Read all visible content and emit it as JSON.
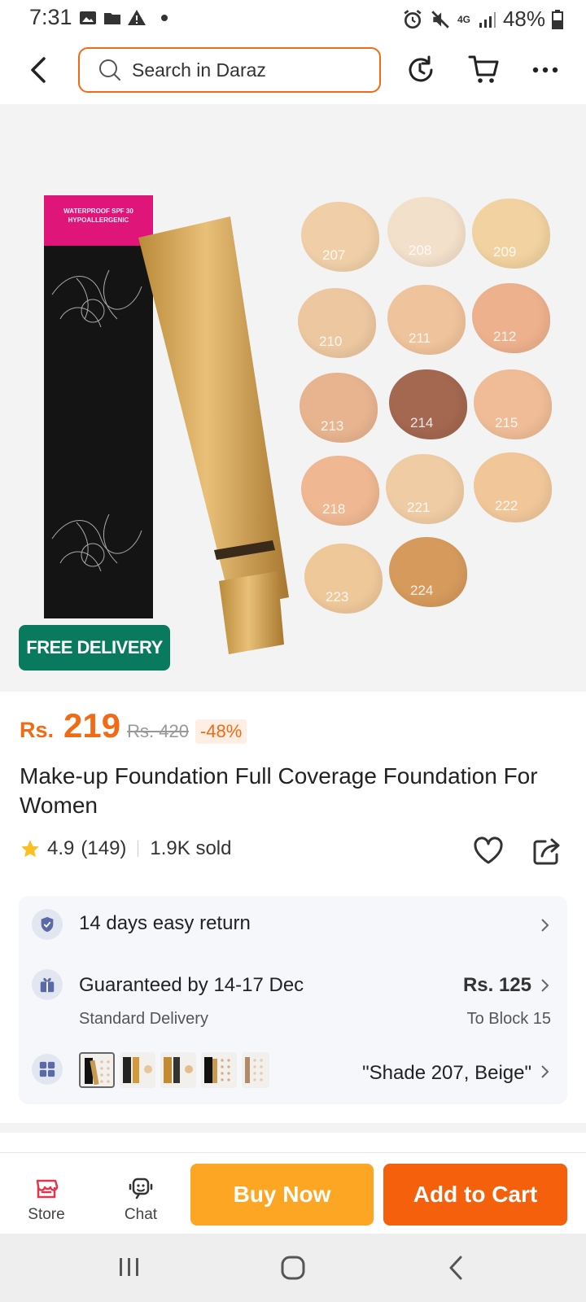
{
  "status_bar": {
    "time": "7:31",
    "network": "4G",
    "battery": "48%",
    "left_icons": [
      "gallery-icon",
      "folder-icon",
      "warning-icon",
      "dot-icon"
    ],
    "right_icons": [
      "alarm-icon",
      "mute-icon",
      "signal-icon",
      "battery-icon"
    ]
  },
  "header": {
    "search_placeholder": "Search in Daraz",
    "icons": [
      "back-icon",
      "search-icon",
      "refresh-icon",
      "cart-icon",
      "more-icon"
    ]
  },
  "product_image": {
    "box_label": "WATERPROOF SPF 30 HYPOALLERGENIC",
    "shades": [
      "207",
      "208",
      "209",
      "210",
      "211",
      "212",
      "213",
      "214",
      "215",
      "218",
      "221",
      "222",
      "223",
      "224"
    ],
    "badge": "FREE DELIVERY"
  },
  "price": {
    "currency": "Rs.",
    "value": "219",
    "original": "Rs. 420",
    "discount": "-48%"
  },
  "product": {
    "title": "Make-up Foundation Full Coverage Foundation For Women",
    "rating": "4.9",
    "reviews": "(149)",
    "sold": "1.9K sold"
  },
  "services": {
    "return": "14 days easy return",
    "guaranteed": "Guaranteed by 14-17 Dec",
    "delivery_type": "Standard Delivery",
    "shipping_fee": "Rs. 125",
    "destination": "To Block 15",
    "selected_variant": "\"Shade 207, Beige\""
  },
  "actions": {
    "store": "Store",
    "chat": "Chat",
    "buy_now": "Buy Now",
    "add_to_cart": "Add to Cart"
  },
  "colors": {
    "brand_orange": "#f36a15",
    "buy_now": "#fda623",
    "add_to_cart": "#f5600d",
    "free_delivery": "#0a7a5f"
  }
}
